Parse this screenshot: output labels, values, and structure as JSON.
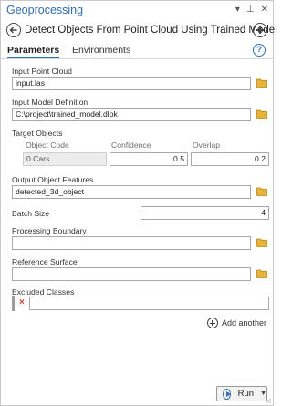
{
  "window": {
    "title": "Geoprocessing",
    "icons": {
      "dropdown": "▾",
      "pin": "⊥",
      "close": "✕"
    }
  },
  "tool": {
    "title": "Detect Objects From Point Cloud Using Trained Model"
  },
  "tabs": [
    {
      "label": "Parameters",
      "active": true
    },
    {
      "label": "Environments",
      "active": false
    }
  ],
  "help": {
    "glyph": "?"
  },
  "params": {
    "input_point_cloud": {
      "label": "Input Point Cloud",
      "value": "input.las"
    },
    "input_model_definition": {
      "label": "Input Model Definition",
      "value": "C:\\project\\trained_model.dlpk"
    },
    "target_objects": {
      "label": "Target Objects",
      "columns": [
        "Object Code",
        "Confidence",
        "Overlap"
      ],
      "rows": [
        {
          "object_code": "0 Cars",
          "confidence": "0.5",
          "overlap": "0.2"
        }
      ]
    },
    "output_object_features": {
      "label": "Output Object Features",
      "value": "detected_3d_object"
    },
    "batch_size": {
      "label": "Batch Size",
      "value": "4"
    },
    "processing_boundary": {
      "label": "Processing Boundary",
      "value": ""
    },
    "reference_surface": {
      "label": "Reference Surface",
      "value": ""
    },
    "excluded_classes": {
      "label": "Excluded Classes",
      "value": "",
      "remove_glyph": "×"
    }
  },
  "add_another": {
    "label": "Add another"
  },
  "run": {
    "label": "Run",
    "caret": "▼"
  },
  "colors": {
    "accent": "#2f6fb5",
    "folder": "#e8b33a",
    "remove": "#d13a2e"
  }
}
